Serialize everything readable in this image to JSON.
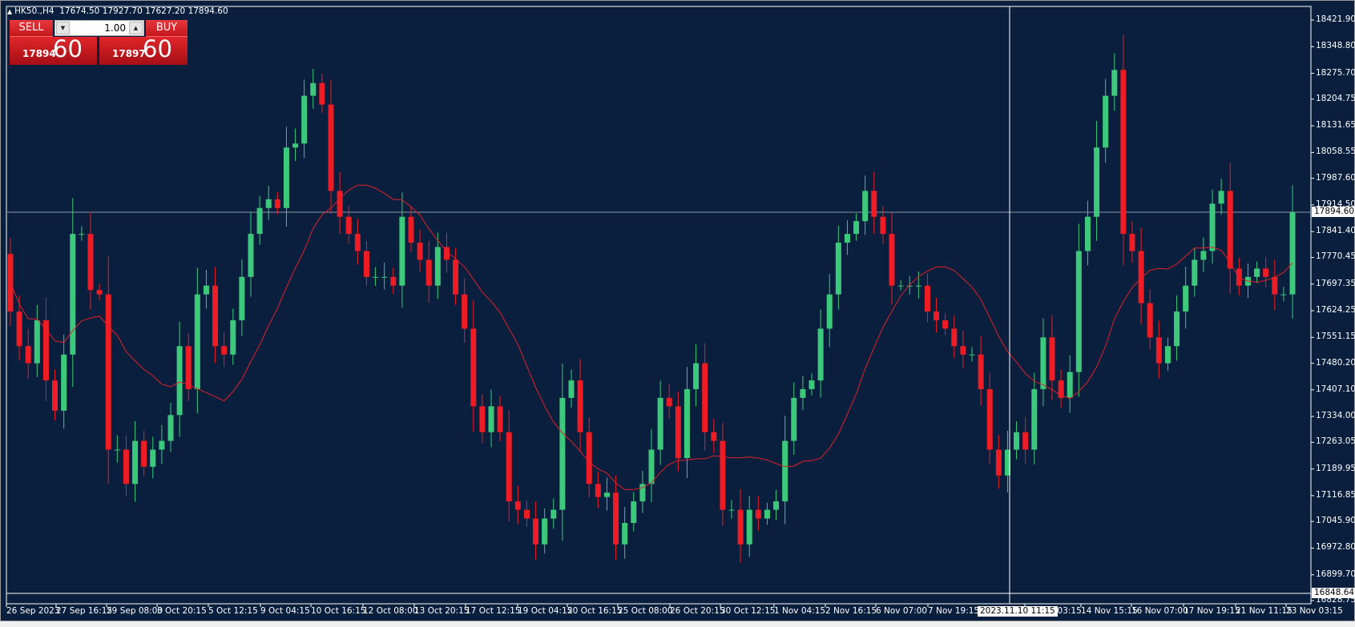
{
  "window": {
    "symbol_line": "HK50.,H4",
    "ohlc_line": "17674.50 17927.70 17627.20 17894.60"
  },
  "trade_panel": {
    "sell_label": "SELL",
    "buy_label": "BUY",
    "lot_value": "1.00",
    "sell_price_small": "17894",
    "sell_price_big": "60",
    "buy_price_small": "17897",
    "buy_price_big": "60"
  },
  "crosshair": {
    "price_label": "16848.64",
    "price_value": 16848.64,
    "time_label": "2023.11.10 11:15"
  },
  "current_price": {
    "label": "17894.60",
    "value": 17894.6
  },
  "colors": {
    "background": "#0a1f3d",
    "bull": "#3cc97b",
    "bear": "#ee1c25",
    "ma": "#e0202a",
    "axis_text": "#ffffff"
  },
  "chart_data": {
    "type": "candlestick",
    "symbol": "HK50.",
    "timeframe": "H4",
    "ylim": [
      16828.75,
      18421.9
    ],
    "y_ticks": [
      "18421.90",
      "18348.80",
      "18275.70",
      "18204.75",
      "18131.65",
      "18058.55",
      "17987.60",
      "17914.50",
      "17841.40",
      "17770.45",
      "17697.35",
      "17624.25",
      "17551.15",
      "17480.20",
      "17407.10",
      "17334.00",
      "17263.05",
      "17189.95",
      "17116.85",
      "17045.90",
      "16972.80",
      "16899.70",
      "16828.75"
    ],
    "x_ticks": [
      "26 Sep 2023",
      "27 Sep 16:15",
      "29 Sep 08:00",
      "3 Oct 20:15",
      "5 Oct 12:15",
      "9 Oct 04:15",
      "10 Oct 16:15",
      "12 Oct 08:00",
      "13 Oct 20:15",
      "17 Oct 12:15",
      "19 Oct 04:15",
      "20 Oct 16:15",
      "25 Oct 08:00",
      "26 Oct 20:15",
      "30 Oct 12:15",
      "1 Nov 04:15",
      "2 Nov 16:15",
      "6 Nov 07:00",
      "7 Nov 19:15",
      "13 Nov 03:15",
      "14 Nov 15:15",
      "16 Nov 07:00",
      "17 Nov 19:15",
      "21 Nov 11:15",
      "23 Nov 03:15"
    ],
    "first_open": 17780,
    "closes": [
      17622,
      17527,
      17480,
      17598,
      17433,
      17350,
      17504,
      17835,
      17835,
      17681,
      17669,
      17243,
      17243,
      17149,
      17267,
      17196,
      17243,
      17267,
      17338,
      17527,
      17409,
      17669,
      17693,
      17527,
      17504,
      17598,
      17717,
      17835,
      17906,
      17930,
      17906,
      18072,
      18083,
      18214,
      18249,
      18190,
      17953,
      17882,
      17835,
      17788,
      17717,
      17717,
      17717,
      17693,
      17882,
      17811,
      17764,
      17693,
      17799,
      17764,
      17669,
      17575,
      17362,
      17291,
      17362,
      17291,
      17101,
      17078,
      17054,
      16983,
      17054,
      17078,
      17385,
      17433,
      17291,
      17149,
      17113,
      17125,
      16983,
      17042,
      17101,
      17149,
      17243,
      17385,
      17362,
      17220,
      17409,
      17480,
      17291,
      17267,
      17078,
      17078,
      16983,
      17078,
      17054,
      17078,
      17101,
      17267,
      17385,
      17409,
      17433,
      17575,
      17669,
      17811,
      17835,
      17870,
      17953,
      17882,
      17835,
      17693,
      17693,
      17693,
      17693,
      17622,
      17598,
      17575,
      17527,
      17504,
      17504,
      17409,
      17243,
      17172,
      17243,
      17291,
      17243,
      17409,
      17551,
      17433,
      17385,
      17456,
      17788,
      17882,
      18072,
      18214,
      18285,
      17835,
      17788,
      17645,
      17551,
      17480,
      17527,
      17622,
      17693,
      17764,
      17788,
      17918,
      17953,
      17740,
      17693,
      17717,
      17740,
      17717,
      17669,
      17669,
      17894.6
    ],
    "ma_period": 14
  }
}
